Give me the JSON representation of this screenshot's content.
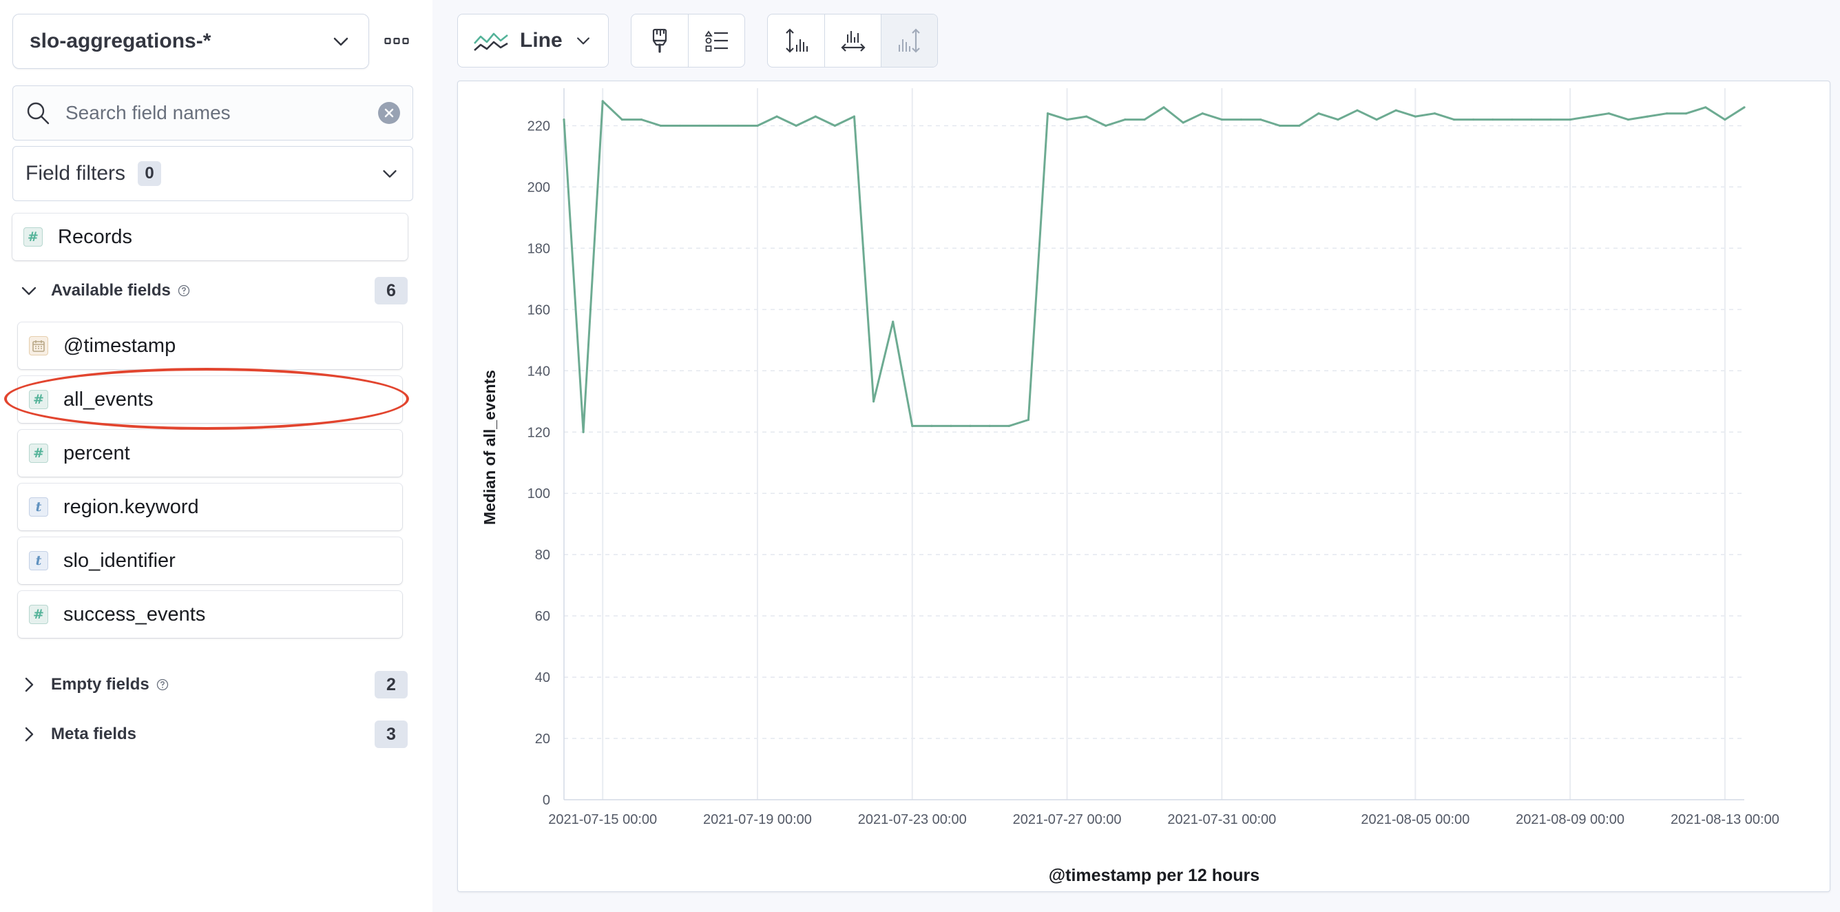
{
  "sidebar": {
    "index_pattern": "slo-aggregations-*",
    "search": {
      "placeholder": "Search field names",
      "value": ""
    },
    "field_filters": {
      "label": "Field filters",
      "count": "0"
    },
    "records": {
      "label": "Records",
      "type": "number"
    },
    "available": {
      "title": "Available fields",
      "count": "6",
      "expanded": true,
      "fields": [
        {
          "name": "@timestamp",
          "type": "date"
        },
        {
          "name": "all_events",
          "type": "number",
          "highlighted": true
        },
        {
          "name": "percent",
          "type": "number"
        },
        {
          "name": "region.keyword",
          "type": "string"
        },
        {
          "name": "slo_identifier",
          "type": "string"
        },
        {
          "name": "success_events",
          "type": "number"
        }
      ]
    },
    "empty": {
      "title": "Empty fields",
      "count": "2",
      "expanded": false
    },
    "meta": {
      "title": "Meta fields",
      "count": "3",
      "expanded": false
    }
  },
  "toolbar": {
    "chart_type_label": "Line",
    "icons": [
      "chart-line-icon",
      "chevron-down-icon",
      "paintbrush-icon",
      "legend-icon",
      "left-axis-icon",
      "bottom-axis-icon",
      "right-axis-icon"
    ]
  },
  "field_type_glyphs": {
    "number": "#",
    "string": "t",
    "date": ""
  },
  "colors": {
    "series": "#6dab92",
    "highlight_ellipse": "#e2452f",
    "number_badge": "#54b399",
    "string_badge": "#6092c0"
  },
  "chart_data": {
    "type": "line",
    "ylabel": "Median of all_events",
    "xlabel": "@timestamp per 12 hours",
    "ylim": [
      0,
      230
    ],
    "yticks": [
      0,
      20,
      40,
      60,
      80,
      100,
      120,
      140,
      160,
      180,
      200,
      220
    ],
    "xticks": [
      {
        "label": "2021-07-15 00:00",
        "t": "2021-07-15T00:00"
      },
      {
        "label": "2021-07-19 00:00",
        "t": "2021-07-19T00:00"
      },
      {
        "label": "2021-07-23 00:00",
        "t": "2021-07-23T00:00"
      },
      {
        "label": "2021-07-27 00:00",
        "t": "2021-07-27T00:00"
      },
      {
        "label": "2021-07-31 00:00",
        "t": "2021-07-31T00:00"
      },
      {
        "label": "2021-08-05 00:00",
        "t": "2021-08-05T00:00"
      },
      {
        "label": "2021-08-09 00:00",
        "t": "2021-08-09T00:00"
      },
      {
        "label": "2021-08-13 00:00",
        "t": "2021-08-13T00:00"
      }
    ],
    "grid": true,
    "series": [
      {
        "x": [
          "2021-07-14T00:00",
          "2021-07-14T12:00",
          "2021-07-15T00:00",
          "2021-07-15T12:00",
          "2021-07-16T00:00",
          "2021-07-16T12:00",
          "2021-07-17T00:00",
          "2021-07-17T12:00",
          "2021-07-18T00:00",
          "2021-07-18T12:00",
          "2021-07-19T00:00",
          "2021-07-19T12:00",
          "2021-07-20T00:00",
          "2021-07-20T12:00",
          "2021-07-21T00:00",
          "2021-07-21T12:00",
          "2021-07-22T00:00",
          "2021-07-22T12:00",
          "2021-07-23T00:00",
          "2021-07-23T12:00",
          "2021-07-24T00:00",
          "2021-07-24T12:00",
          "2021-07-25T00:00",
          "2021-07-25T12:00",
          "2021-07-26T00:00",
          "2021-07-26T12:00",
          "2021-07-27T00:00",
          "2021-07-27T12:00",
          "2021-07-28T00:00",
          "2021-07-28T12:00",
          "2021-07-29T00:00",
          "2021-07-29T12:00",
          "2021-07-30T00:00",
          "2021-07-30T12:00",
          "2021-07-31T00:00",
          "2021-07-31T12:00",
          "2021-08-01T00:00",
          "2021-08-01T12:00",
          "2021-08-02T00:00",
          "2021-08-02T12:00",
          "2021-08-03T00:00",
          "2021-08-03T12:00",
          "2021-08-04T00:00",
          "2021-08-04T12:00",
          "2021-08-05T00:00",
          "2021-08-05T12:00",
          "2021-08-06T00:00",
          "2021-08-06T12:00",
          "2021-08-07T00:00",
          "2021-08-07T12:00",
          "2021-08-08T00:00",
          "2021-08-08T12:00",
          "2021-08-09T00:00",
          "2021-08-09T12:00",
          "2021-08-10T00:00",
          "2021-08-10T12:00",
          "2021-08-11T00:00",
          "2021-08-11T12:00",
          "2021-08-12T00:00",
          "2021-08-12T12:00",
          "2021-08-13T00:00",
          "2021-08-13T12:00"
        ],
        "y": [
          222,
          120,
          228,
          222,
          222,
          220,
          220,
          220,
          220,
          220,
          220,
          223,
          220,
          223,
          220,
          223,
          130,
          156,
          122,
          122,
          122,
          122,
          122,
          122,
          124,
          224,
          222,
          223,
          220,
          222,
          222,
          226,
          221,
          224,
          222,
          222,
          222,
          220,
          220,
          224,
          222,
          225,
          222,
          225,
          223,
          224,
          222,
          222,
          222,
          222,
          222,
          222,
          222,
          223,
          224,
          222,
          223,
          224,
          224,
          226,
          222,
          226
        ]
      }
    ]
  }
}
